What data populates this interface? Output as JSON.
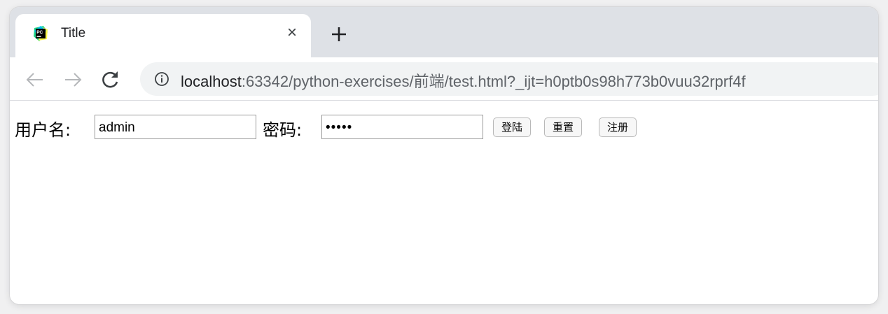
{
  "browser": {
    "tab": {
      "title": "Title",
      "close_glyph": "×",
      "favicon": "pycharm-favicon"
    },
    "new_tab_glyph": "+",
    "address": {
      "host": "localhost",
      "rest": ":63342/python-exercises/前端/test.html?_ijt=h0ptb0s98h773b0vuu32rprf4f"
    }
  },
  "form": {
    "username_label": "用户名:",
    "username_value": "admin",
    "password_label": "密码:",
    "password_value": "•••••",
    "buttons": {
      "login": "登陆",
      "reset": "重置",
      "register": "注册"
    }
  },
  "colors": {
    "tab_strip": "#dee1e6",
    "omnibox": "#f1f3f4",
    "page_bg": "#ffffff"
  }
}
